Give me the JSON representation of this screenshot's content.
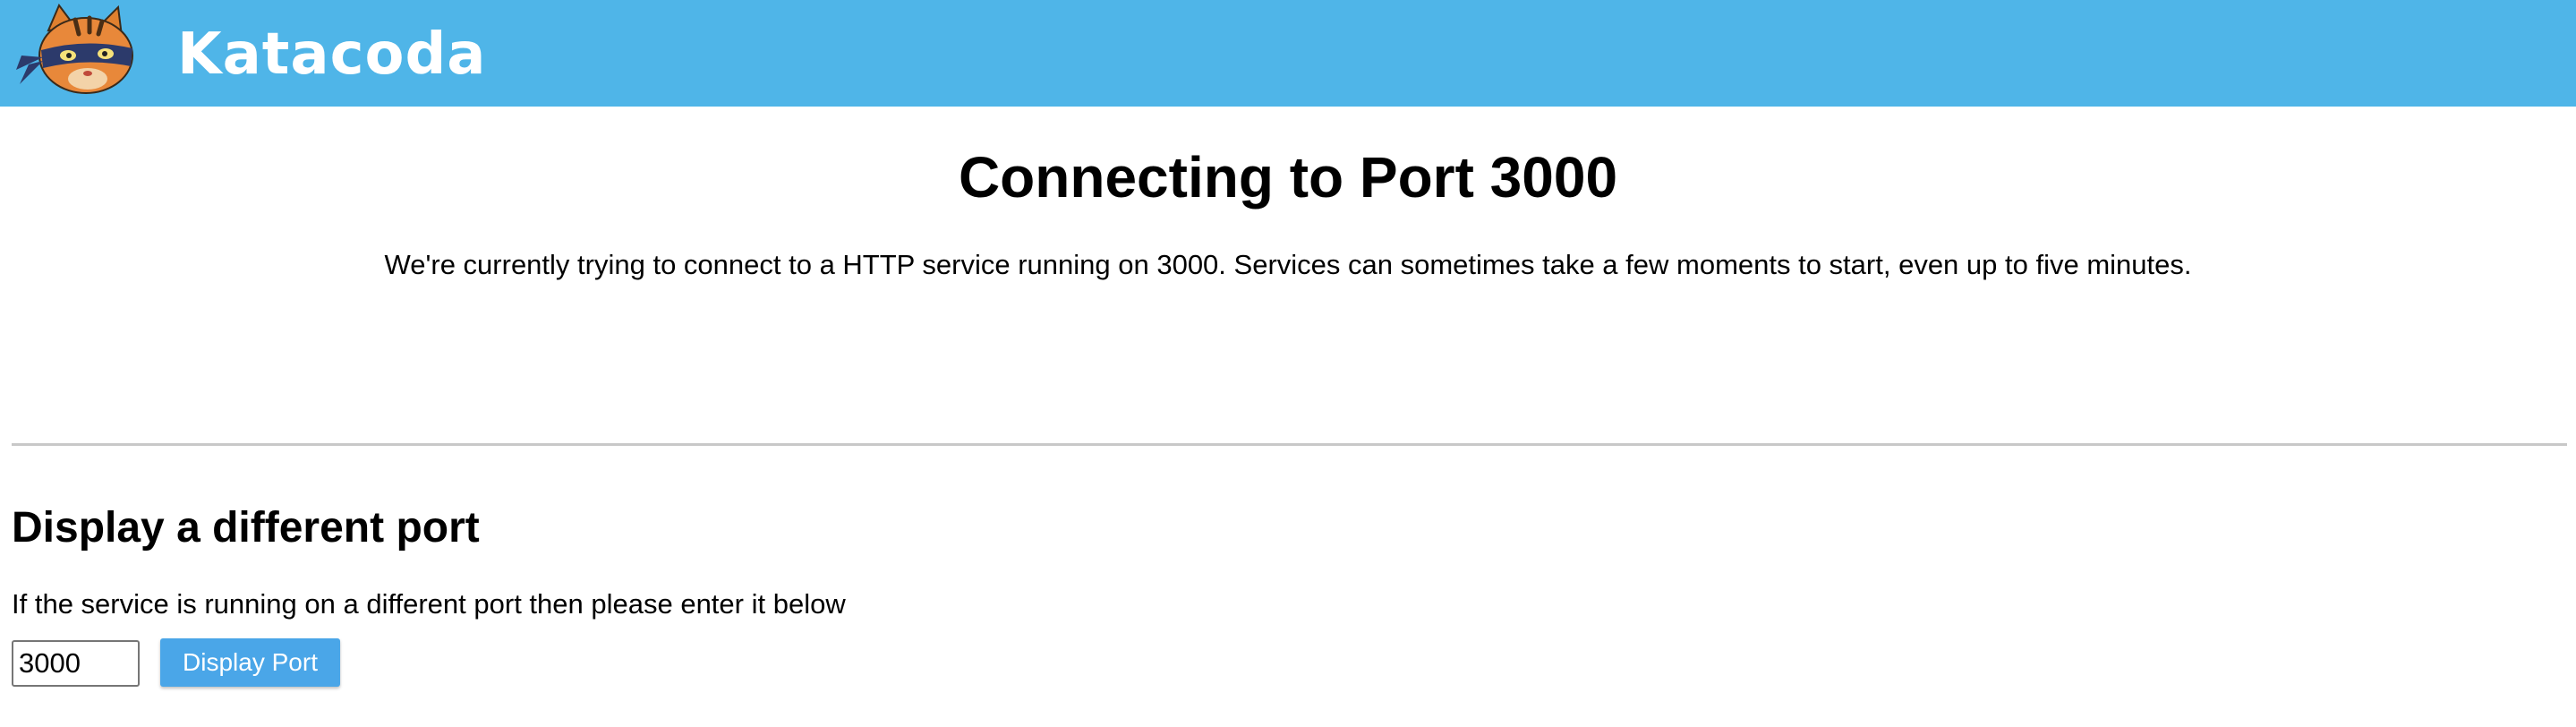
{
  "header": {
    "logo_text": "Katacoda",
    "mascot_icon": "katacoda-cat-ninja-logo",
    "background_color": "#4fb5e8"
  },
  "hero": {
    "title": "Connecting to Port 3000",
    "description": "We're currently trying to connect to a HTTP service running on 3000. Services can sometimes take a few moments to start, even up to five minutes."
  },
  "different_port": {
    "title": "Display a different port",
    "description": "If the service is running on a different port then please enter it below",
    "input_value": "3000",
    "button_label": "Display Port",
    "button_color": "#4aa6e8"
  }
}
